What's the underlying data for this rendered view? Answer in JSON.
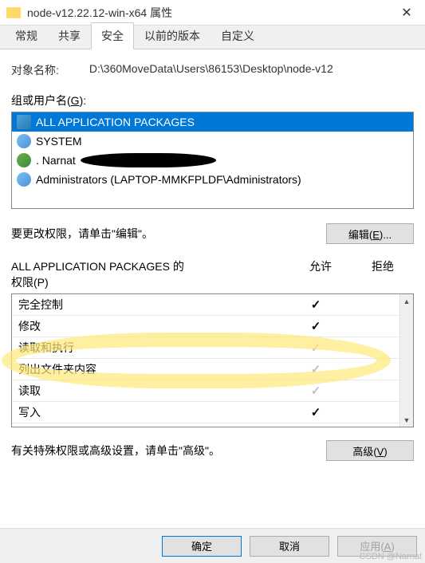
{
  "window": {
    "title": "node-v12.22.12-win-x64 属性"
  },
  "tabs": [
    "常规",
    "共享",
    "安全",
    "以前的版本",
    "自定义"
  ],
  "active_tab_index": 2,
  "object": {
    "label": "对象名称:",
    "path": "D:\\360MoveData\\Users\\86153\\Desktop\\node-v12"
  },
  "groups": {
    "label_prefix": "组或用户名(",
    "label_key": "G",
    "label_suffix": "):",
    "items": [
      {
        "name": "ALL APPLICATION PACKAGES",
        "icon": "pkg",
        "selected": true,
        "redacted": false
      },
      {
        "name": "SYSTEM",
        "icon": "users",
        "selected": false,
        "redacted": false
      },
      {
        "name": ". Narnat",
        "icon": "user",
        "selected": false,
        "redacted": true
      },
      {
        "name": "Administrators (LAPTOP-MMKFPLDF\\Administrators)",
        "icon": "users",
        "selected": false,
        "redacted": false
      }
    ]
  },
  "edit": {
    "text": "要更改权限，请单击\"编辑\"。",
    "button_prefix": "编辑(",
    "button_key": "E",
    "button_suffix": ")..."
  },
  "permissions": {
    "header_left_line1": "ALL APPLICATION PACKAGES 的",
    "header_left_line2_prefix": "权限(",
    "header_left_key": "P",
    "header_left_line2_suffix": ")",
    "col_allow": "允许",
    "col_deny": "拒绝",
    "rows": [
      {
        "name": "完全控制",
        "allow": "black",
        "deny": ""
      },
      {
        "name": "修改",
        "allow": "black",
        "deny": ""
      },
      {
        "name": "读取和执行",
        "allow": "gray",
        "deny": ""
      },
      {
        "name": "列出文件夹内容",
        "allow": "gray",
        "deny": ""
      },
      {
        "name": "读取",
        "allow": "gray",
        "deny": ""
      },
      {
        "name": "写入",
        "allow": "black",
        "deny": ""
      }
    ]
  },
  "advanced": {
    "text": "有关特殊权限或高级设置，请单击\"高级\"。",
    "button_prefix": "高级(",
    "button_key": "V",
    "button_suffix": ")"
  },
  "buttons": {
    "ok": "确定",
    "cancel": "取消",
    "apply_prefix": "应用(",
    "apply_key": "A",
    "apply_suffix": ")"
  },
  "watermark": "CSDN @Narnat"
}
